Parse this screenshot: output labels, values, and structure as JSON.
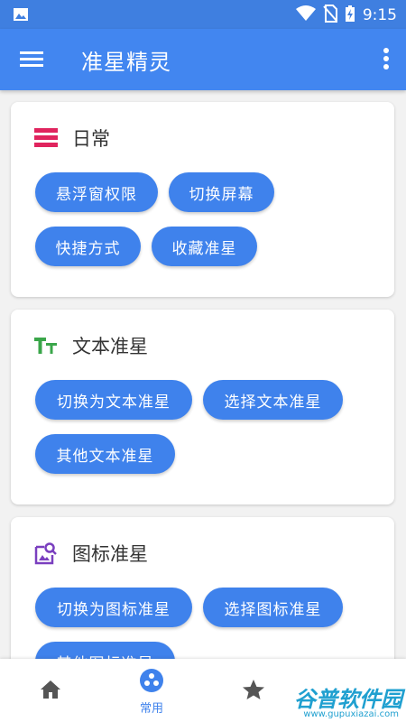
{
  "status_bar": {
    "time": "9:15"
  },
  "app_bar": {
    "title": "准星精灵"
  },
  "cards": [
    {
      "title": "日常",
      "buttons": [
        "悬浮窗权限",
        "切换屏幕",
        "快捷方式",
        "收藏准星"
      ]
    },
    {
      "title": "文本准星",
      "buttons": [
        "切换为文本准星",
        "选择文本准星",
        "其他文本准星"
      ]
    },
    {
      "title": "图标准星",
      "buttons": [
        "切换为图标准星",
        "选择图标准星",
        "其他图标准星"
      ]
    }
  ],
  "bottom_nav": {
    "active_label": "常用"
  },
  "watermark": {
    "text": "谷普软件园",
    "url": "www.gupuxiazai.com"
  },
  "colors": {
    "primary": "#4286f0",
    "button": "#3f82ec",
    "daily_icon": "#e0245e",
    "text_icon": "#3aa64a",
    "image_icon": "#7a3fbf"
  }
}
